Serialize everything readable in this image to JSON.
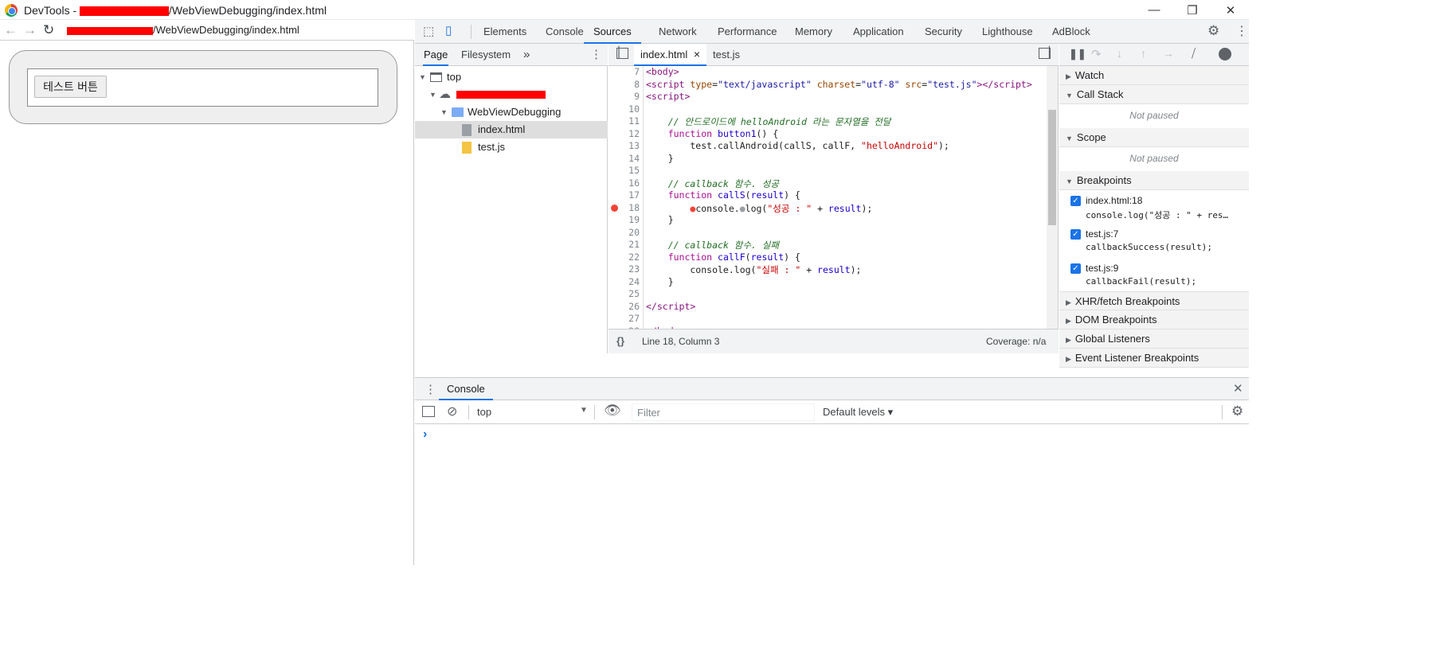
{
  "window": {
    "title_prefix": "DevTools - ",
    "title_suffix": "/WebViewDebugging/index.html",
    "minimize": "—",
    "maximize": "❐",
    "close": "✕"
  },
  "address": {
    "url_suffix": "/WebViewDebugging/index.html"
  },
  "page": {
    "button_label": "테스트 버튼"
  },
  "devtools": {
    "tabs": [
      "Elements",
      "Console",
      "Sources",
      "Network",
      "Performance",
      "Memory",
      "Application",
      "Security",
      "Lighthouse",
      "AdBlock"
    ],
    "active_tab": "Sources",
    "navigator": {
      "tabs": [
        "Page",
        "Filesystem"
      ],
      "more": "»",
      "tree": {
        "top": "top",
        "folder": "WebViewDebugging",
        "file1": "index.html",
        "file2": "test.js"
      }
    },
    "editor": {
      "tabs": [
        "index.html",
        "test.js"
      ],
      "close": "×",
      "status_position": "Line 18, Column 3",
      "status_coverage": "Coverage: n/a",
      "format_icon": "{}"
    },
    "debugger": {
      "sections": {
        "watch": "Watch",
        "call_stack": "Call Stack",
        "scope": "Scope",
        "breakpoints": "Breakpoints",
        "xhr": "XHR/fetch Breakpoints",
        "dom": "DOM Breakpoints",
        "global": "Global Listeners",
        "event": "Event Listener Breakpoints"
      },
      "not_paused": "Not paused",
      "breakpoints": [
        {
          "location": "index.html:18",
          "code": "console.log(\"성공 : \" + res…"
        },
        {
          "location": "test.js:7",
          "code": "callbackSuccess(result);"
        },
        {
          "location": "test.js:9",
          "code": "callbackFail(result);"
        }
      ]
    },
    "console": {
      "tab": "Console",
      "context": "top",
      "filter_placeholder": "Filter",
      "levels": "Default levels ▾",
      "prompt": "›"
    }
  }
}
